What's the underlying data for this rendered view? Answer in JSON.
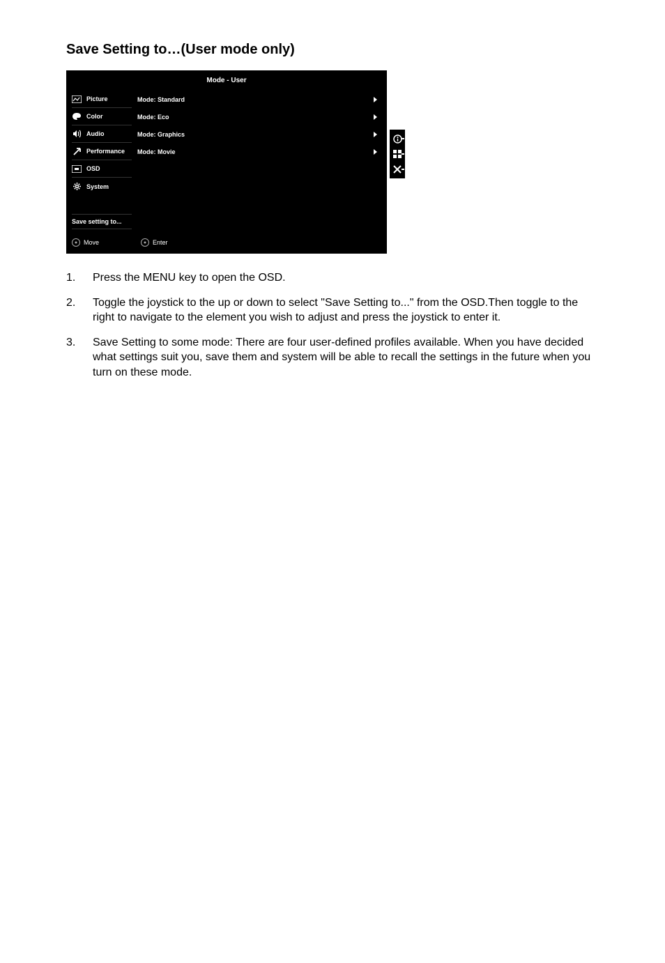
{
  "title": "Save Setting to…(User mode only)",
  "osd": {
    "header": "Mode - User",
    "sidebar": [
      {
        "name": "picture",
        "label": "Picture"
      },
      {
        "name": "color",
        "label": "Color"
      },
      {
        "name": "audio",
        "label": "Audio"
      },
      {
        "name": "performance",
        "label": "Performance"
      },
      {
        "name": "osd",
        "label": "OSD"
      },
      {
        "name": "system",
        "label": "System"
      }
    ],
    "modes": [
      "Mode: Standard",
      "Mode: Eco",
      "Mode: Graphics",
      "Mode: Movie"
    ],
    "save_label": "Save setting to...",
    "footer": {
      "move": "Move",
      "enter": "Enter"
    }
  },
  "side_icons": [
    "info",
    "grid",
    "close"
  ],
  "instructions": [
    "Press the MENU key to open the OSD.",
    "Toggle the joystick to the up or down to select \"Save Setting to...\" from the OSD.Then toggle to the right to navigate to the element you wish to adjust and press the joystick to enter it.",
    "Save Setting to some mode: There are four user-defined profiles available. When you have decided what settings suit you, save them and system will be able to recall the settings in the future when you turn on these mode."
  ]
}
